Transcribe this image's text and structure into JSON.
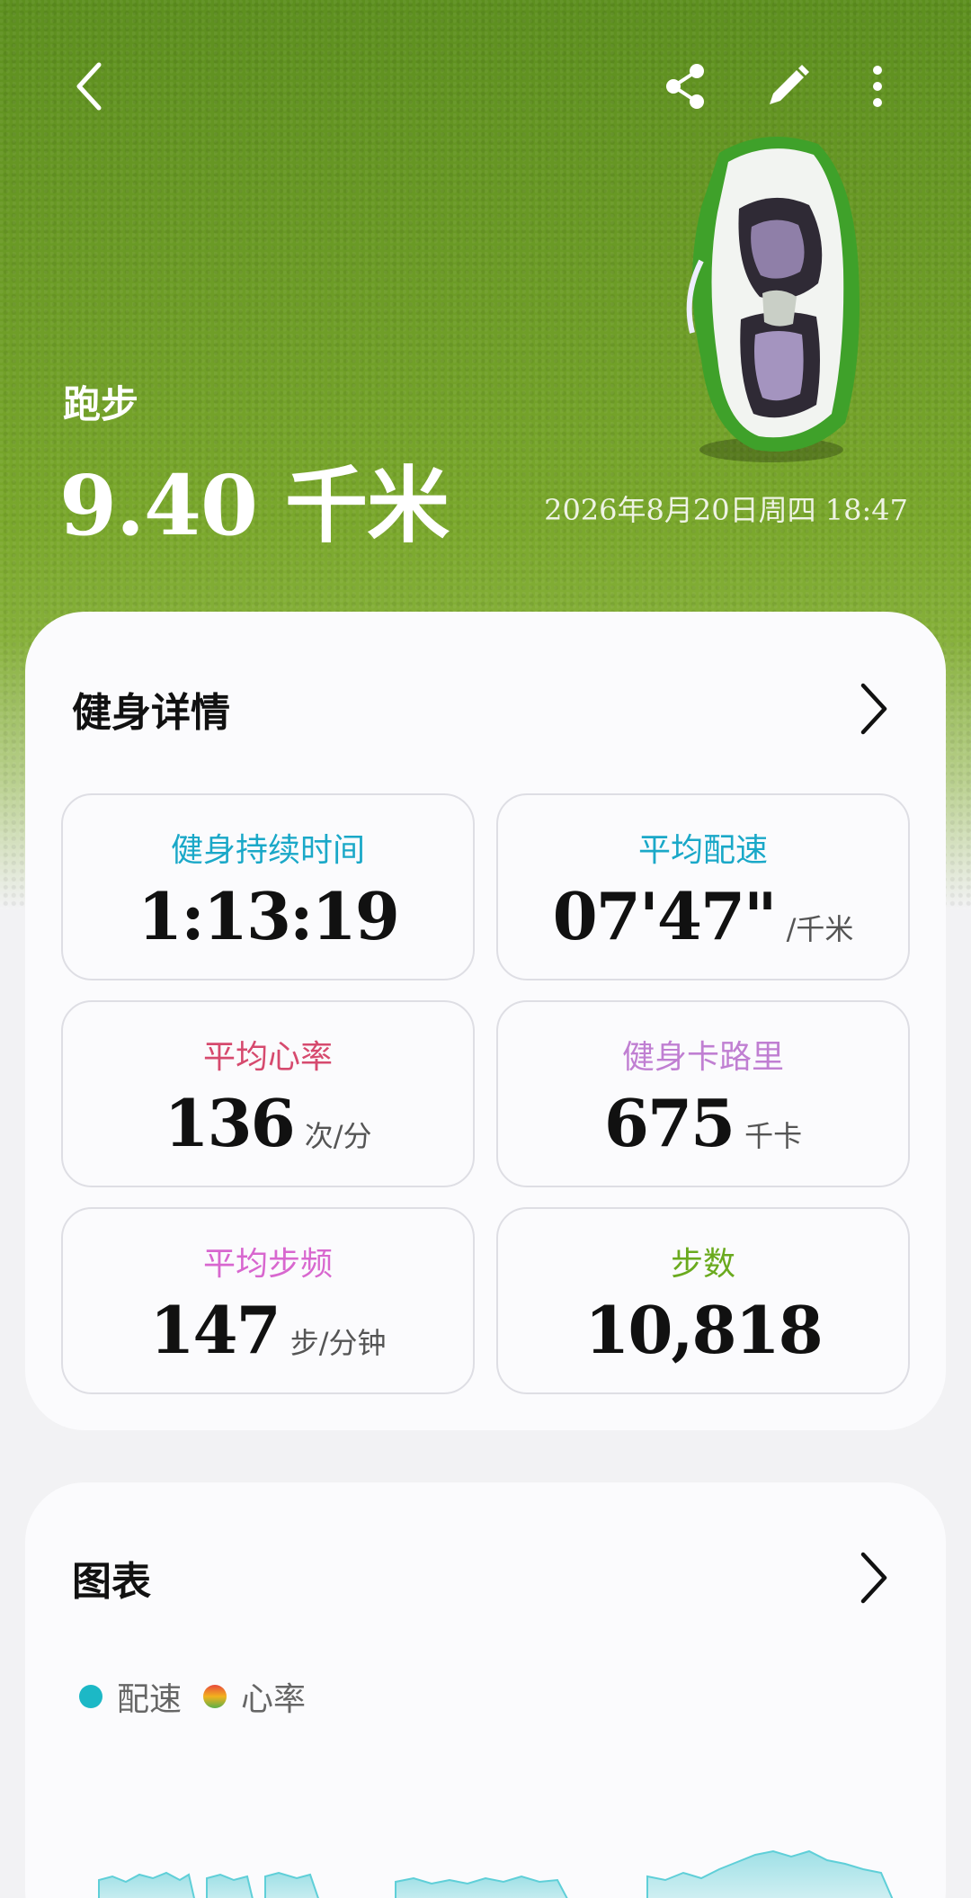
{
  "header": {
    "activity": "跑步",
    "distance": "9.40 千米",
    "date": "2026年8月20日周四 18:47"
  },
  "details": {
    "title": "健身详情",
    "stats": [
      {
        "label": "健身持续时间",
        "value": "1:13:19",
        "unit": "",
        "color": "#1aa8c8"
      },
      {
        "label": "平均配速",
        "value": "07'47\"",
        "unit": "/千米",
        "color": "#1aa8c8"
      },
      {
        "label": "平均心率",
        "value": "136",
        "unit": "次/分",
        "color": "#d64a6e"
      },
      {
        "label": "健身卡路里",
        "value": "675",
        "unit": "千卡",
        "color": "#c07fd2"
      },
      {
        "label": "平均步频",
        "value": "147",
        "unit": "步/分钟",
        "color": "#d867cf"
      },
      {
        "label": "步数",
        "value": "10,818",
        "unit": "",
        "color": "#6aaa1e"
      }
    ]
  },
  "charts": {
    "title": "图表",
    "legend": [
      {
        "label": "配速",
        "color": "#1cb8c6"
      },
      {
        "label": "心率",
        "color": "gradient"
      }
    ]
  },
  "icons": [
    "back-icon",
    "share-icon",
    "edit-icon",
    "more-icon",
    "chevron-right-icon"
  ]
}
